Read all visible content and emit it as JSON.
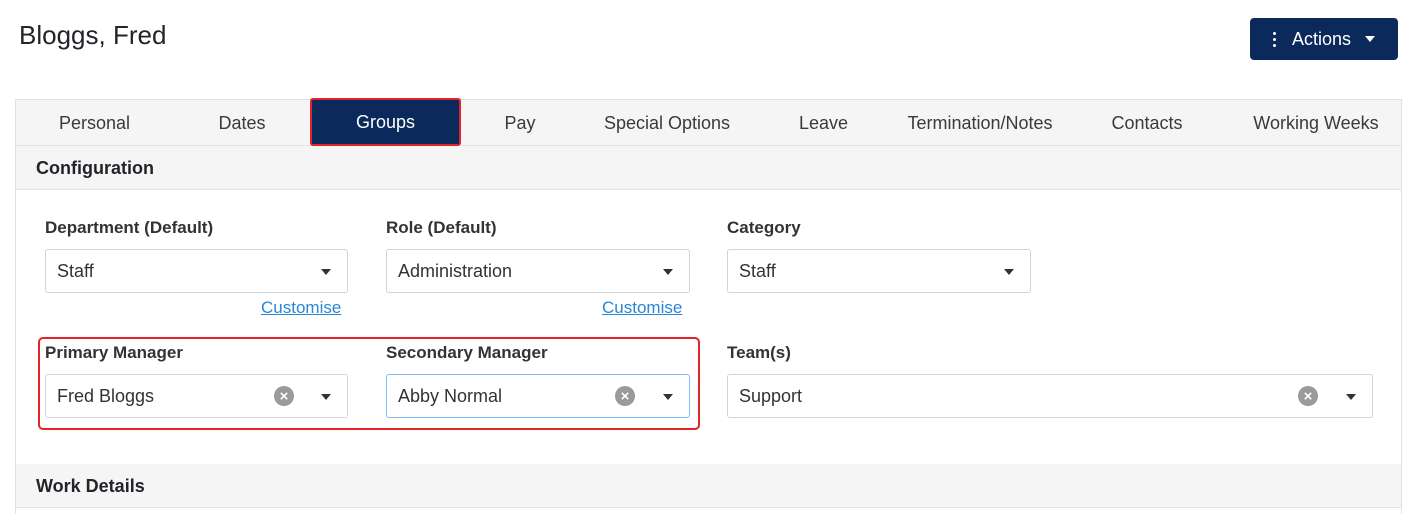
{
  "page": {
    "title": "Bloggs, Fred"
  },
  "actions": {
    "label": "Actions"
  },
  "tabs": [
    {
      "label": "Personal"
    },
    {
      "label": "Dates"
    },
    {
      "label": "Groups"
    },
    {
      "label": "Pay"
    },
    {
      "label": "Special Options"
    },
    {
      "label": "Leave"
    },
    {
      "label": "Termination/Notes"
    },
    {
      "label": "Contacts"
    },
    {
      "label": "Working Weeks"
    }
  ],
  "active_tab": "Groups",
  "sections": {
    "configuration": "Configuration",
    "work_details": "Work Details"
  },
  "fields": {
    "department": {
      "label": "Department (Default)",
      "value": "Staff",
      "link": "Customise"
    },
    "role": {
      "label": "Role (Default)",
      "value": "Administration",
      "link": "Customise"
    },
    "category": {
      "label": "Category",
      "value": "Staff"
    },
    "primary_manager": {
      "label": "Primary Manager",
      "value": "Fred Bloggs"
    },
    "secondary_manager": {
      "label": "Secondary Manager",
      "value": "Abby Normal"
    },
    "teams": {
      "label": "Team(s)",
      "value": "Support"
    }
  },
  "colors": {
    "primary": "#0b2a5b",
    "highlight": "#e0242a",
    "link": "#2a86d6"
  }
}
